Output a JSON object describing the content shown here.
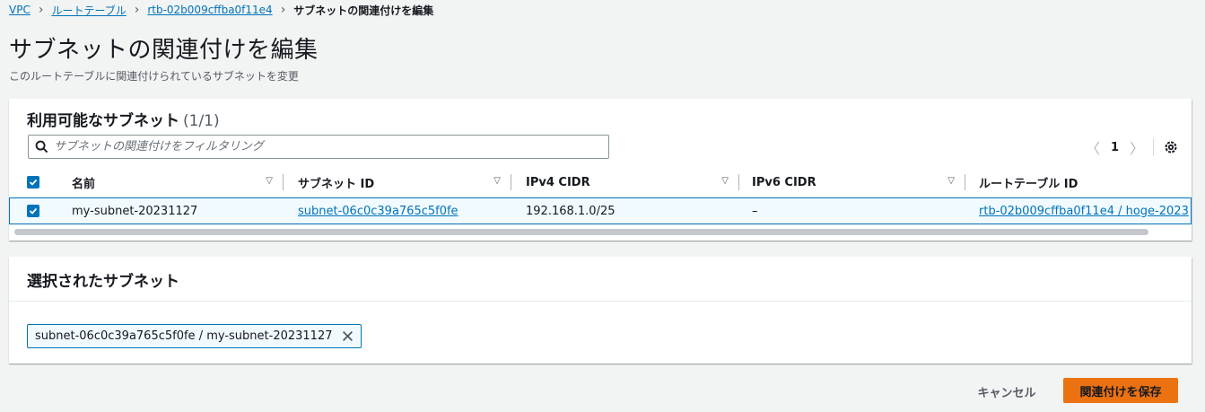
{
  "breadcrumb": {
    "items": [
      "VPC",
      "ルートテーブル",
      "rtb-02b009cffba0f11e4"
    ],
    "current": "サブネットの関連付けを編集"
  },
  "page": {
    "title": "サブネットの関連付けを編集",
    "description": "このルートテーブルに関連付けられているサブネットを変更"
  },
  "available_subnets": {
    "title": "利用可能なサブネット",
    "count": "(1/1)",
    "filter_placeholder": "サブネットの関連付けをフィルタリング",
    "page_number": "1",
    "columns": [
      "名前",
      "サブネット ID",
      "IPv4 CIDR",
      "IPv6 CIDR",
      "ルートテーブル ID"
    ],
    "rows": [
      {
        "name": "my-subnet-20231127",
        "subnet_id": "subnet-06c0c39a765c5f0fe",
        "ipv4_cidr": "192.168.1.0/25",
        "ipv6_cidr": "–",
        "route_table_id": "rtb-02b009cffba0f11e4 / hoge-2023"
      }
    ]
  },
  "selected_subnets": {
    "title": "選択されたサブネット",
    "tokens": [
      "subnet-06c0c39a765c5f0fe / my-subnet-20231127"
    ]
  },
  "actions": {
    "cancel_label": "キャンセル",
    "save_label": "関連付けを保存"
  },
  "colors": {
    "link": "#0073bb",
    "primary_button": "#ec7211",
    "selected_row_bg": "#f1faff",
    "page_bg": "#f2f3f3"
  }
}
